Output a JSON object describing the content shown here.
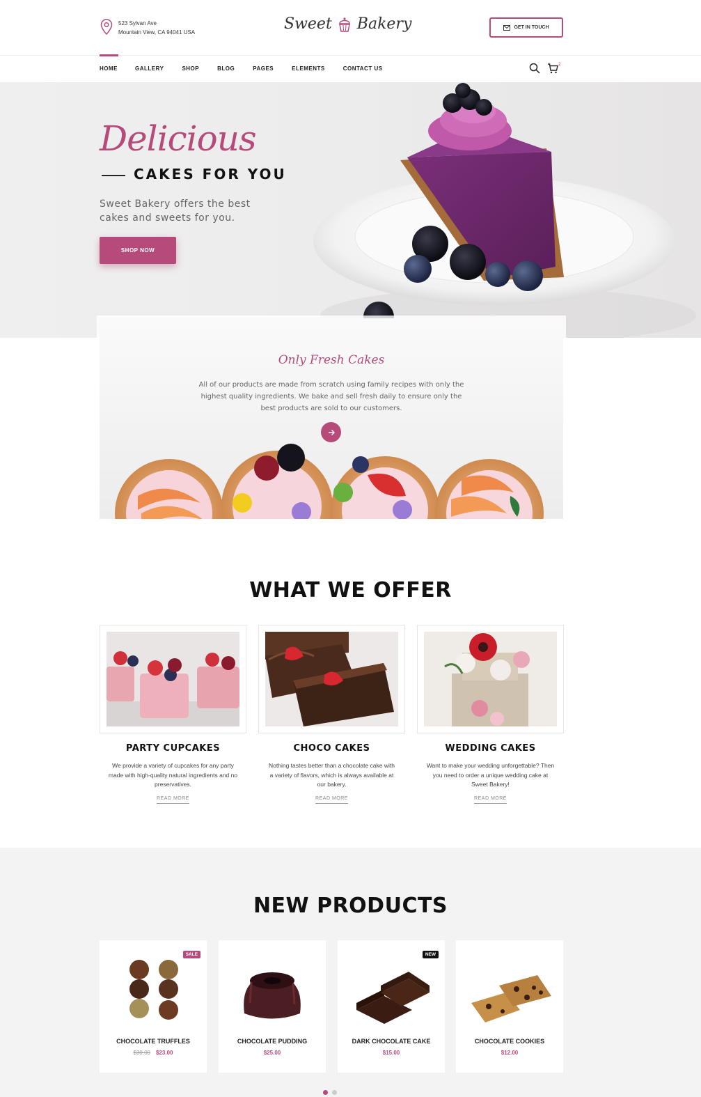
{
  "header": {
    "address_line1": "523 Sylvan Ave",
    "address_line2": "Mountain View, CA 94041 USA",
    "logo_left": "Sweet",
    "logo_right": "Bakery",
    "get_in_touch": "GET IN TOUCH",
    "icons": [
      "location-pin-icon",
      "cupcake-icon",
      "mail-icon"
    ]
  },
  "nav": {
    "items": [
      "HOME",
      "GALLERY",
      "SHOP",
      "BLOG",
      "PAGES",
      "ELEMENTS",
      "CONTACT US"
    ],
    "active": "HOME",
    "cart_count": "2",
    "icons": [
      "search-icon",
      "cart-icon"
    ]
  },
  "hero": {
    "script_title": "Delicious",
    "subtitle": "CAKES FOR YOU",
    "description": "Sweet Bakery offers the best cakes and sweets for you.",
    "button": "SHOP NOW"
  },
  "fresh": {
    "title": "Only Fresh Cakes",
    "text": "All of our products are made from scratch using family recipes with only the highest quality ingredients. We bake and sell fresh daily to ensure only the best products are sold to our customers.",
    "icon": "arrow-right-icon"
  },
  "offer": {
    "title": "WHAT WE OFFER",
    "items": [
      {
        "name": "PARTY CUPCAKES",
        "desc": "We provide a variety of cupcakes for any party made with high-quality natural ingredients and no preservatives.",
        "more": "READ MORE"
      },
      {
        "name": "CHOCO CAKES",
        "desc": "Nothing tastes better than a chocolate cake with a variety of flavors, which is always available at our bakery.",
        "more": "READ MORE"
      },
      {
        "name": "WEDDING CAKES",
        "desc": "Want to make your wedding unforgettable? Then you need to order a unique wedding cake at Sweet Bakery!",
        "more": "READ MORE"
      }
    ]
  },
  "products": {
    "title": "NEW PRODUCTS",
    "items": [
      {
        "name": "CHOCOLATE TRUFFLES",
        "old_price": "$30.00",
        "price": "$23.00",
        "badge": "SALE"
      },
      {
        "name": "CHOCOLATE PUDDING",
        "old_price": "",
        "price": "$25.00",
        "badge": ""
      },
      {
        "name": "DARK CHOCOLATE CAKE",
        "old_price": "",
        "price": "$15.00",
        "badge": "NEW"
      },
      {
        "name": "CHOCOLATE COOKIES",
        "old_price": "",
        "price": "$12.00",
        "badge": ""
      }
    ]
  },
  "colors": {
    "accent": "#b64a7a",
    "dark": "#111111"
  }
}
